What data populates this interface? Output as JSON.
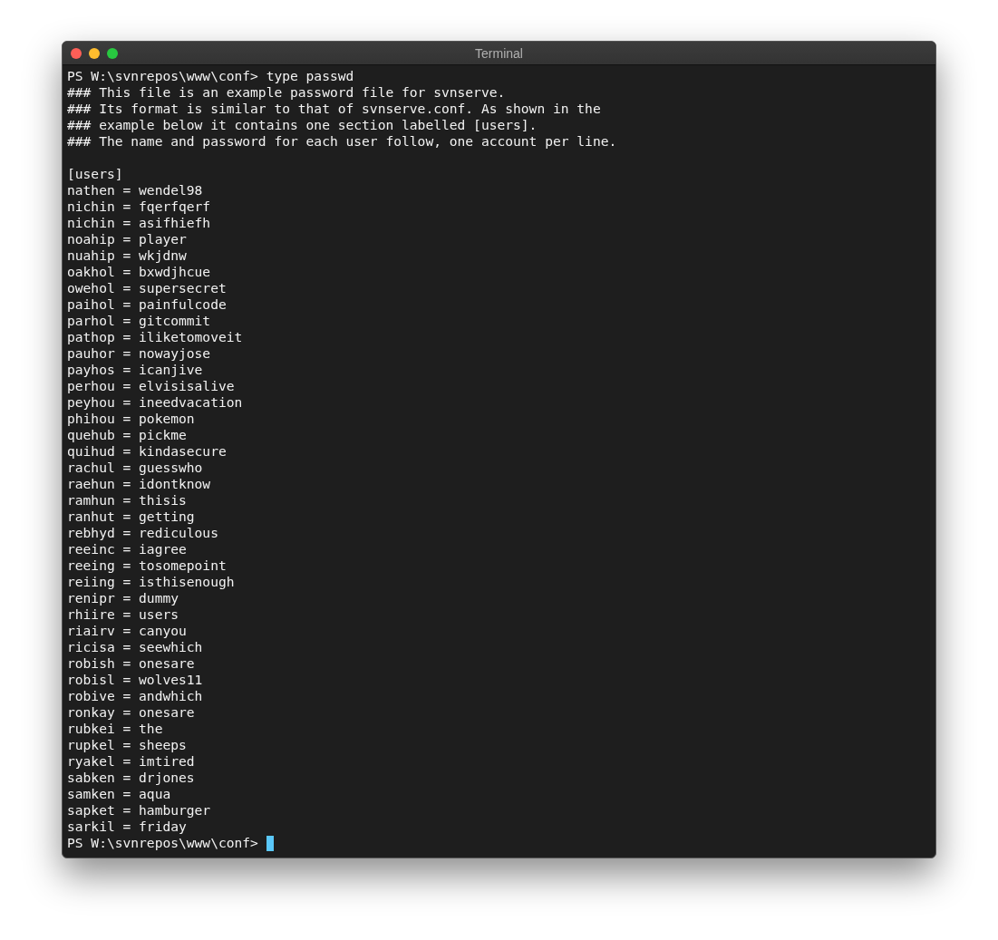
{
  "window": {
    "title": "Terminal"
  },
  "command": "PS W:\\svnrepos\\www\\conf> type passwd",
  "comments": [
    "### This file is an example password file for svnserve.",
    "### Its format is similar to that of svnserve.conf. As shown in the",
    "### example below it contains one section labelled [users].",
    "### The name and password for each user follow, one account per line."
  ],
  "section": "[users]",
  "entries": [
    "nathen = wendel98",
    "nichin = fqerfqerf",
    "nichin = asifhiefh",
    "noahip = player",
    "nuahip = wkjdnw",
    "oakhol = bxwdjhcue",
    "owehol = supersecret",
    "paihol = painfulcode",
    "parhol = gitcommit",
    "pathop = iliketomoveit",
    "pauhor = nowayjose",
    "payhos = icanjive",
    "perhou = elvisisalive",
    "peyhou = ineedvacation",
    "phihou = pokemon",
    "quehub = pickme",
    "quihud = kindasecure",
    "rachul = guesswho",
    "raehun = idontknow",
    "ramhun = thisis",
    "ranhut = getting",
    "rebhyd = rediculous",
    "reeinc = iagree",
    "reeing = tosomepoint",
    "reiing = isthisenough",
    "renipr = dummy",
    "rhiire = users",
    "riairv = canyou",
    "ricisa = seewhich",
    "robish = onesare",
    "robisl = wolves11",
    "robive = andwhich",
    "ronkay = onesare",
    "rubkei = the",
    "rupkel = sheeps",
    "ryakel = imtired",
    "sabken = drjones",
    "samken = aqua",
    "sapket = hamburger",
    "sarkil = friday"
  ],
  "prompt": "PS W:\\svnrepos\\www\\conf>"
}
